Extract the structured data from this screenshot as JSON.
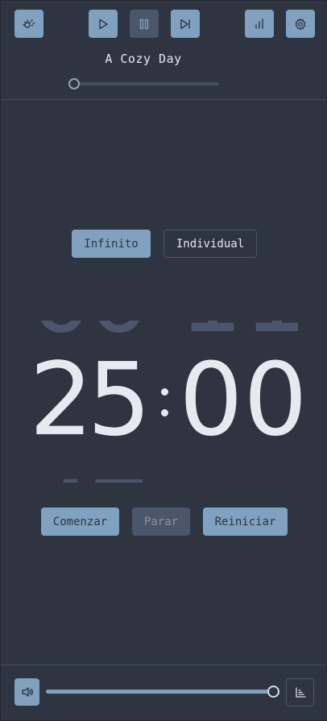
{
  "player": {
    "track_title": "A Cozy Day",
    "progress": 0.0
  },
  "icons": {
    "weather": "sun-cloud-icon",
    "play": "play-icon",
    "pause": "pause-icon",
    "next": "skip-next-icon",
    "stats": "bar-chart-icon",
    "settings": "gear-icon",
    "volume": "speaker-icon",
    "chart": "chart-axis-icon"
  },
  "modes": {
    "infinite": "Infinito",
    "individual": "Individual",
    "active": "Infinito"
  },
  "timer": {
    "minutes_tens": "2",
    "minutes_ones": "5",
    "seconds_tens": "0",
    "seconds_ones": "0"
  },
  "actions": {
    "start": "Comenzar",
    "stop": "Parar",
    "reset": "Reiniciar"
  },
  "volume": {
    "level": 1.0
  },
  "colors": {
    "background": "#2e3440",
    "accent": "#81a1c1",
    "muted": "#4c566a",
    "text": "#e5e9f0"
  }
}
